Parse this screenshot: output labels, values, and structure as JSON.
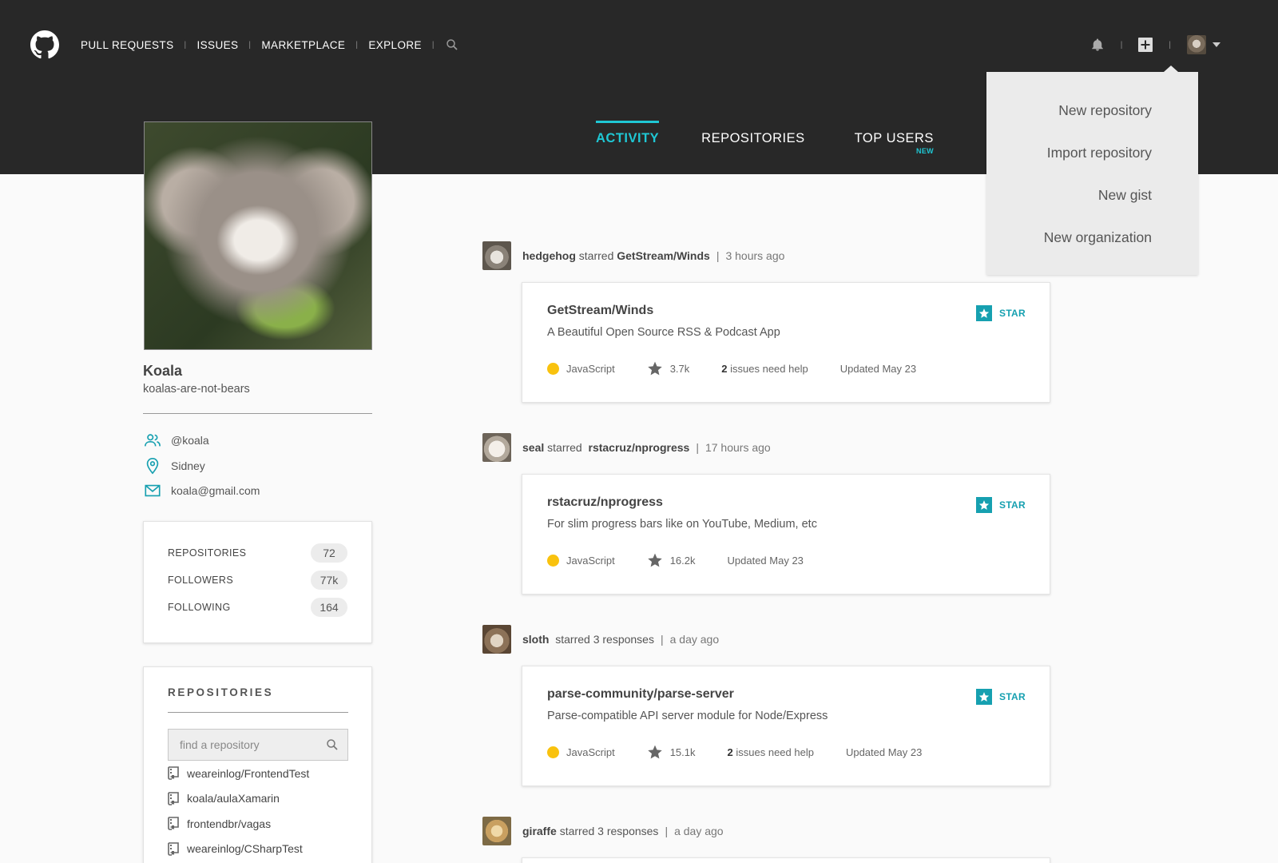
{
  "nav": {
    "items": [
      "PULL REQUESTS",
      "ISSUES",
      "MARKETPLACE",
      "EXPLORE"
    ],
    "separator": "|"
  },
  "tabs": [
    {
      "label": "ACTIVITY",
      "active": true
    },
    {
      "label": "REPOSITORIES",
      "active": false
    },
    {
      "label": "TOP USERS",
      "active": false,
      "badge": "NEW"
    }
  ],
  "dropdown": {
    "items": [
      "New repository",
      "Import repository",
      "New gist",
      "New organization"
    ]
  },
  "profile": {
    "name": "Koala",
    "username": "koalas-are-not-bears",
    "handle": "@koala",
    "location": "Sidney",
    "email": "koala@gmail.com",
    "stats": [
      {
        "label": "REPOSITORIES",
        "value": "72"
      },
      {
        "label": "FOLLOWERS",
        "value": "77k"
      },
      {
        "label": "FOLLOWING",
        "value": "164"
      }
    ]
  },
  "repos": {
    "title": "REPOSITORIES",
    "search_placeholder": "find a repository",
    "items": [
      "weareinlog/FrontendTest",
      "koala/aulaXamarin",
      "frontendbr/vagas",
      "weareinlog/CSharpTest"
    ]
  },
  "events": [
    {
      "user": "hedgehog",
      "action": "starred",
      "target": "GetStream/Winds",
      "target_bold": true,
      "time": "3 hours ago",
      "card": {
        "title": "GetStream/Winds",
        "description": "A Beautiful Open Source RSS & Podcast App",
        "language": "JavaScript",
        "stars": "3.7k",
        "issues_count": "2",
        "issues_text": "issues need help",
        "updated": "Updated May 23",
        "star_label": "STAR"
      }
    },
    {
      "user": "seal",
      "action": "starred",
      "target": "rstacruz/nprogress",
      "target_bold": true,
      "time": "17 hours ago",
      "card": {
        "title": "rstacruz/nprogress",
        "description": "For slim progress bars like on YouTube, Medium, etc",
        "language": "JavaScript",
        "stars": "16.2k",
        "updated": "Updated May 23",
        "star_label": "STAR"
      }
    },
    {
      "user": "sloth",
      "action": "starred",
      "target": "3 responses",
      "target_bold": false,
      "time": "a day ago",
      "card": {
        "title": "parse-community/parse-server",
        "description": "Parse-compatible API server module for Node/Express",
        "language": "JavaScript",
        "stars": "15.1k",
        "issues_count": "2",
        "issues_text": "issues need help",
        "updated": "Updated May 23",
        "star_label": "STAR"
      }
    },
    {
      "user": "giraffe",
      "action": "starred",
      "target": "3 responses",
      "target_bold": false,
      "time": "a day ago"
    }
  ],
  "colors": {
    "accent": "#1fc7d4",
    "star_teal": "#16a0b0",
    "topbar": "#282828",
    "js_dot": "#f9c20e"
  },
  "icons": [
    "github-logo-icon",
    "search-icon",
    "bell-icon",
    "plus-square-icon",
    "users-icon",
    "location-pin-icon",
    "mail-icon",
    "repo-book-icon",
    "star-icon"
  ]
}
